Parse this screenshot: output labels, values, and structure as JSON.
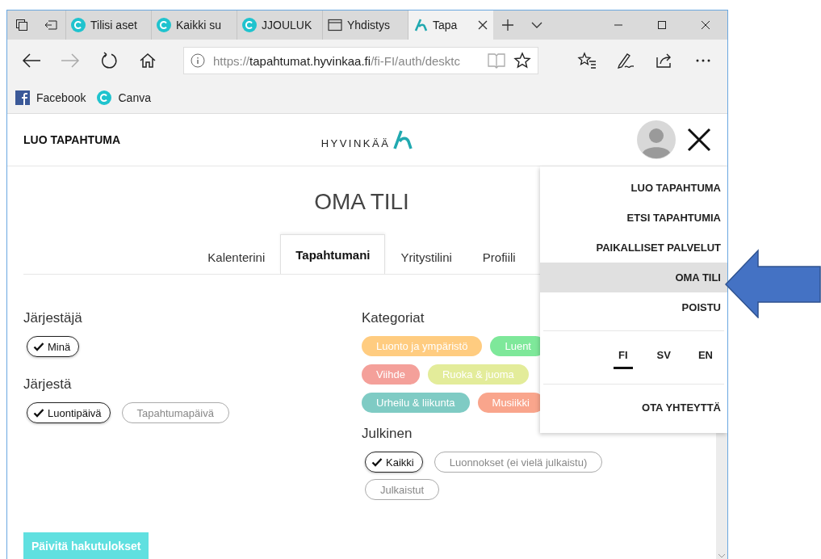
{
  "browser_tabs": [
    {
      "label": "Tilisi aset",
      "kind": "canva",
      "selected": false
    },
    {
      "label": "Kaikki su",
      "kind": "canva",
      "selected": false
    },
    {
      "label": "JJOULUK",
      "kind": "canva",
      "selected": false
    },
    {
      "label": "Yhdistys",
      "kind": "page",
      "selected": false
    },
    {
      "label": "Tapa",
      "kind": "site",
      "selected": true
    }
  ],
  "address": {
    "scheme": "https://",
    "host": "tapahtumat.hyvinkaa.fi",
    "path": "/fi-FI/auth/desktc"
  },
  "favorites": [
    {
      "label": "Facebook",
      "kind": "facebook"
    },
    {
      "label": "Canva",
      "kind": "canva"
    }
  ],
  "header": {
    "create_link": "LUO TAPAHTUMA",
    "logo_text": "HYVINKÄÄ"
  },
  "title": "OMA TILI",
  "tabs": [
    {
      "label": "Kalenterini",
      "selected": false
    },
    {
      "label": "Tapahtumani",
      "selected": true
    },
    {
      "label": "Yritystilini",
      "selected": false
    },
    {
      "label": "Profiili",
      "selected": false
    }
  ],
  "organizer": {
    "heading": "Järjestäjä",
    "options": [
      {
        "label": "Minä",
        "checked": true
      }
    ]
  },
  "sort": {
    "heading": "Järjestä",
    "options": [
      {
        "label": "Luontipäivä",
        "checked": true
      },
      {
        "label": "Tapahtumapäivä",
        "checked": false
      }
    ]
  },
  "categories": {
    "heading": "Kategoriat",
    "rows": [
      [
        {
          "label": "Luonto ja ympäristö",
          "color": "#ffcc80"
        },
        {
          "label": "Luent",
          "color": "#7ee89a"
        }
      ],
      [
        {
          "label": "Viihde",
          "color": "#f4a09a"
        },
        {
          "label": "Ruoka & juoma",
          "color": "#e3ec9a"
        }
      ],
      [
        {
          "label": "Urheilu & liikunta",
          "color": "#7fcbc4"
        },
        {
          "label": "Musiikki",
          "color": "#f9a58c"
        }
      ]
    ]
  },
  "public": {
    "heading": "Julkinen",
    "options": [
      {
        "label": "Kaikki",
        "checked": true
      },
      {
        "label": "Luonnokset (ei vielä julkaistu)",
        "checked": false
      },
      {
        "label": "Julkaistut",
        "checked": false
      }
    ]
  },
  "update_button": "Päivitä hakutulokset",
  "menu": {
    "items": [
      {
        "label": "LUO TAPAHTUMA",
        "selected": false
      },
      {
        "label": "ETSI TAPAHTUMIA",
        "selected": false
      },
      {
        "label": "PAIKALLISET PALVELUT",
        "selected": false
      },
      {
        "label": "OMA TILI",
        "selected": true
      },
      {
        "label": "POISTU",
        "selected": false
      }
    ],
    "languages": [
      {
        "label": "FI",
        "selected": true
      },
      {
        "label": "SV",
        "selected": false
      },
      {
        "label": "EN",
        "selected": false
      }
    ],
    "contact": "OTA YHTEYTTÄ"
  }
}
